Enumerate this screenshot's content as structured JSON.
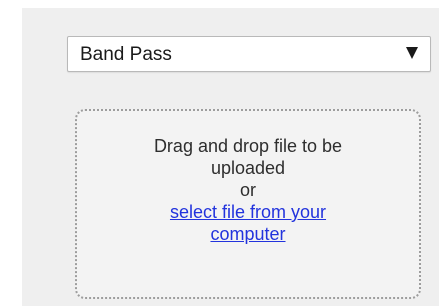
{
  "filter_select": {
    "value": "Band Pass",
    "arrow_icon": "triangle-down-icon"
  },
  "upload": {
    "prompt_line1": "Drag and drop file to be",
    "prompt_line2": "uploaded",
    "or_text": "or",
    "link_line1": "select file from your",
    "link_line2": "computer"
  },
  "colors": {
    "panel_background": "#efefef",
    "link": "#2233dd",
    "dotted_border": "#9d9d9d"
  }
}
